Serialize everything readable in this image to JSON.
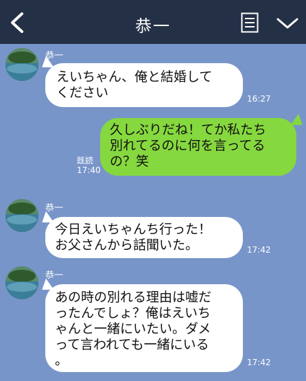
{
  "header": {
    "title": "恭一",
    "back_icon": "chevron-left-icon",
    "menu_icon": "note-list-icon",
    "expand_icon": "chevron-down-icon"
  },
  "messages": [
    {
      "sender": "恭一",
      "lines": [
        "えいちゃん、俺と結婚して",
        "ください"
      ],
      "time": "16:27"
    },
    {
      "read": "既読",
      "time": "17:40",
      "lines": [
        "久しぶりだね！てか私たち",
        "別れてるのに何を言ってる",
        "の？笑"
      ]
    },
    {
      "sender": "恭一",
      "lines": [
        "今日えいちゃんち行った！",
        "お父さんから話聞いた。"
      ],
      "time": "17:42"
    },
    {
      "sender": "恭一",
      "lines": [
        "あの時の別れる理由は嘘だ",
        "ったんでしょ？俺はえいち",
        "ゃんと一緒にいたい。ダメ",
        "って言われても一緒にいる",
        "。"
      ],
      "time": "17:42"
    }
  ],
  "colors": {
    "background": "#7895c9",
    "header": "#243046",
    "incoming_bubble": "#ffffff",
    "outgoing_bubble": "#86d83f"
  }
}
